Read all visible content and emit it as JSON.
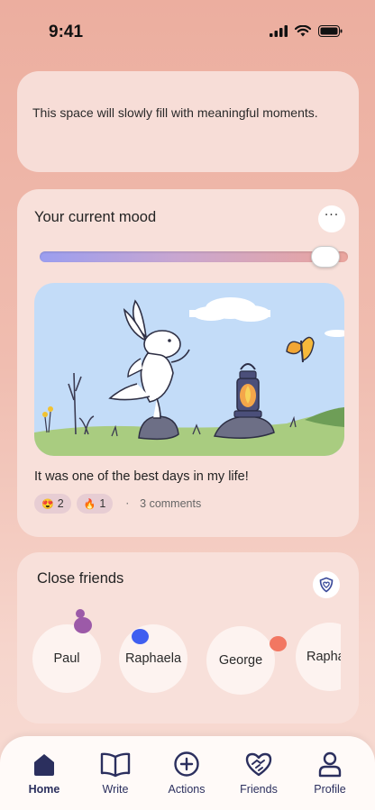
{
  "status_bar": {
    "time": "9:41"
  },
  "intro": {
    "text": "This space will slowly fill with meaningful moments."
  },
  "mood": {
    "title": "Your current mood",
    "more_label": "···",
    "slider_level": 0.97,
    "image_icon": "rabbit-lantern-illustration",
    "caption": "It was one of the best days in my life!",
    "reactions": [
      {
        "emoji": "😍",
        "count": "2"
      },
      {
        "emoji": "🔥",
        "count": "1"
      }
    ],
    "separator": "·",
    "comments": "3 comments"
  },
  "friends": {
    "title": "Close friends",
    "items": [
      {
        "name": "Paul",
        "dot_color": "#9c5aa8"
      },
      {
        "name": "Raphaela",
        "dot_color": "#3f5ff0"
      },
      {
        "name": "George",
        "dot_color": "#f27762"
      },
      {
        "name": "Raphaela",
        "dot_color": ""
      }
    ]
  },
  "tabs": [
    {
      "label": "Home",
      "icon": "home-icon",
      "active": true
    },
    {
      "label": "Write",
      "icon": "book-icon",
      "active": false
    },
    {
      "label": "Actions",
      "icon": "plus-circle-icon",
      "active": false
    },
    {
      "label": "Friends",
      "icon": "heart-handshake-icon",
      "active": false
    },
    {
      "label": "Profile",
      "icon": "person-icon",
      "active": false
    }
  ],
  "colors": {
    "accent": "#2b2f5e",
    "background": "#ecae9f",
    "card": "#f8e0da"
  }
}
